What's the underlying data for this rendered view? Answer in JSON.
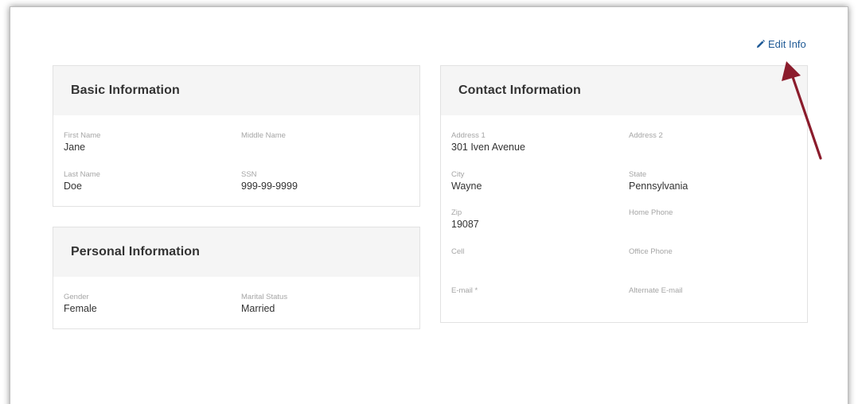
{
  "header": {
    "edit_label": "Edit Info"
  },
  "basic": {
    "title": "Basic Information",
    "first_name_label": "First Name",
    "first_name_value": "Jane",
    "middle_name_label": "Middle Name",
    "middle_name_value": "",
    "last_name_label": "Last Name",
    "last_name_value": "Doe",
    "ssn_label": "SSN",
    "ssn_value": "999-99-9999"
  },
  "personal": {
    "title": "Personal Information",
    "gender_label": "Gender",
    "gender_value": "Female",
    "marital_label": "Marital Status",
    "marital_value": "Married"
  },
  "contact": {
    "title": "Contact Information",
    "address1_label": "Address 1",
    "address1_value": "301 Iven Avenue",
    "address2_label": "Address 2",
    "address2_value": "",
    "city_label": "City",
    "city_value": "Wayne",
    "state_label": "State",
    "state_value": "Pennsylvania",
    "zip_label": "Zip",
    "zip_value": "19087",
    "home_phone_label": "Home Phone",
    "home_phone_value": "",
    "cell_label": "Cell",
    "cell_value": "",
    "office_phone_label": "Office Phone",
    "office_phone_value": "",
    "email_label": "E-mail *",
    "email_value": "",
    "alt_email_label": "Alternate E-mail",
    "alt_email_value": ""
  },
  "colors": {
    "link": "#1f5a96",
    "annotation_arrow": "#8b1c2c",
    "card_header_bg": "#f5f5f5"
  }
}
